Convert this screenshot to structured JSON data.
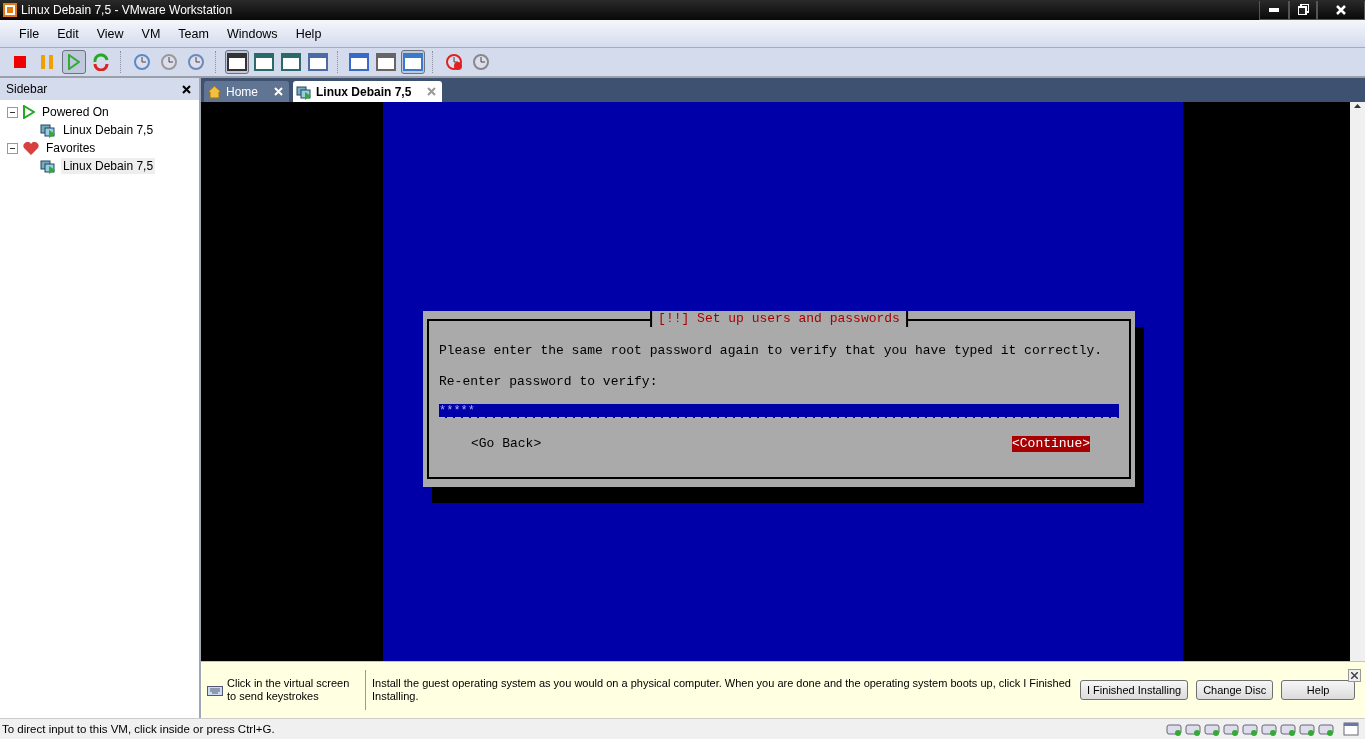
{
  "window": {
    "title": "Linux Debain 7,5 - VMware Workstation"
  },
  "menu": [
    "File",
    "Edit",
    "View",
    "VM",
    "Team",
    "Windows",
    "Help"
  ],
  "toolbar": [
    [
      {
        "kind": "stop",
        "selected": false
      },
      {
        "kind": "pause",
        "selected": false
      },
      {
        "kind": "play",
        "selected": true
      },
      {
        "kind": "reset",
        "selected": false
      }
    ],
    [
      {
        "kind": "snapshot",
        "selected": false
      },
      {
        "kind": "revert",
        "selected": false
      },
      {
        "kind": "manage",
        "selected": false
      }
    ],
    [
      {
        "kind": "sidebar",
        "selected": true
      },
      {
        "kind": "fullscreen",
        "selected": false
      },
      {
        "kind": "fitwindow",
        "selected": false
      },
      {
        "kind": "unity",
        "selected": false
      }
    ],
    [
      {
        "kind": "console",
        "selected": false
      },
      {
        "kind": "thumbnail",
        "selected": false
      },
      {
        "kind": "tabs",
        "selected": true
      }
    ],
    [
      {
        "kind": "record",
        "selected": false
      },
      {
        "kind": "replay",
        "selected": false
      }
    ]
  ],
  "sidebar": {
    "title": "Sidebar",
    "groups": [
      {
        "label": "Powered On",
        "kind": "power",
        "expanded": true,
        "children": [
          {
            "label": "Linux Debain 7,5",
            "selected": false
          }
        ]
      },
      {
        "label": "Favorites",
        "kind": "favorite",
        "expanded": true,
        "children": [
          {
            "label": "Linux Debain 7,5",
            "selected": true
          }
        ]
      }
    ]
  },
  "tabs": [
    {
      "label": "Home",
      "kind": "home",
      "selected": false
    },
    {
      "label": "Linux Debain 7,5",
      "kind": "vm",
      "selected": true
    }
  ],
  "dialog": {
    "title": "[!!] Set up users and passwords",
    "message": "Please enter the same root password again to verify that you have typed it correctly.",
    "prompt": "Re-enter password to verify:",
    "value": "*****",
    "buttons": [
      {
        "label": "<Go Back>",
        "selected": false
      },
      {
        "label": "<Continue>",
        "selected": true
      }
    ]
  },
  "hint": {
    "keyboard_text": "Click in the virtual screen to send keystrokes",
    "message": "Install the guest operating system as you would on a physical computer. When you are done and the operating system boots up, click I Finished Installing.",
    "buttons": [
      "I Finished Installing",
      "Change Disc",
      "Help"
    ]
  },
  "status_bar": {
    "text": "To direct input to this VM, click inside or press Ctrl+G."
  }
}
